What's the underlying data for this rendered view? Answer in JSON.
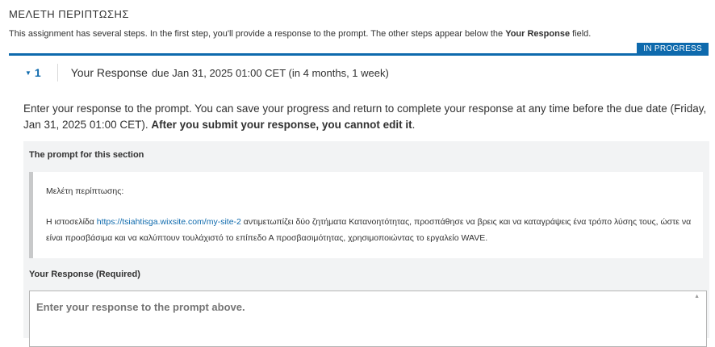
{
  "assignment": {
    "title": "ΜΕΛΕΤΗ ΠΕΡΙΠΤΩΣΗΣ",
    "intro_text": "This assignment has several steps. In the first step, you'll provide a response to the prompt. The other steps appear below the ",
    "intro_bold": "Your Response",
    "intro_suffix": " field.",
    "status": "IN PROGRESS",
    "accent_color": "#0e6aad"
  },
  "step": {
    "number": "1",
    "toggle_icon": "triangle-down-icon",
    "title": "Your Response",
    "due": "due Jan 31, 2025 01:00 CET (in 4 months, 1 week)"
  },
  "instructions": {
    "text": "Enter your response to the prompt. You can save your progress and return to complete your response at any time before the due date (Friday, Jan 31, 2025 01:00 CET). ",
    "bold": "After you submit your response, you cannot edit it",
    "suffix": "."
  },
  "prompt": {
    "heading": "The prompt for this section",
    "line1": "Μελέτη περίπτωσης:",
    "line2_prefix": "Η ιστοσελίδα ",
    "link": "https://tsiahtisga.wixsite.com/my-site-2",
    "line2_suffix": " αντιμετωπίζει δύο ζητήματα Κατανοητότητας, προσπάθησε να βρεις και να καταγράψεις ένα τρόπο λύσης τους, ώστε να είναι προσβάσιμα και να καλύπτουν τουλάχιστό το επίπεδο Α προσβασιμότητας, χρησιμοποιώντας το εργαλείο WAVE."
  },
  "response": {
    "label": "Your Response (Required)",
    "placeholder": "Enter your response to the prompt above."
  }
}
